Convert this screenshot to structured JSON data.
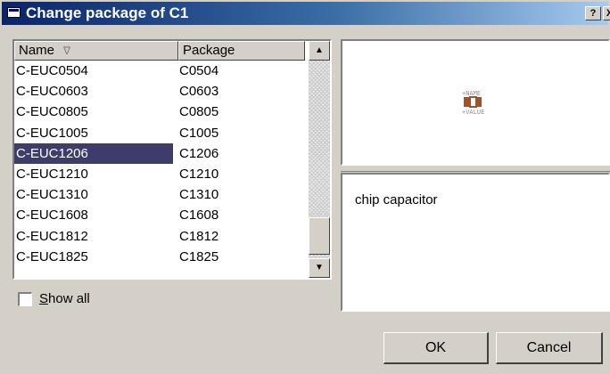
{
  "window": {
    "title": "Change package of C1",
    "help_label": "?",
    "close_label": "X"
  },
  "list": {
    "columns": {
      "name": "Name",
      "package": "Package"
    },
    "sort_indicator": "∇",
    "rows": [
      {
        "name": "C-EUC0504",
        "package": "C0504",
        "selected": false
      },
      {
        "name": "C-EUC0603",
        "package": "C0603",
        "selected": false
      },
      {
        "name": "C-EUC0805",
        "package": "C0805",
        "selected": false
      },
      {
        "name": "C-EUC1005",
        "package": "C1005",
        "selected": false
      },
      {
        "name": "C-EUC1206",
        "package": "C1206",
        "selected": true
      },
      {
        "name": "C-EUC1210",
        "package": "C1210",
        "selected": false
      },
      {
        "name": "C-EUC1310",
        "package": "C1310",
        "selected": false
      },
      {
        "name": "C-EUC1608",
        "package": "C1608",
        "selected": false
      },
      {
        "name": "C-EUC1812",
        "package": "C1812",
        "selected": false
      },
      {
        "name": "C-EUC1825",
        "package": "C1825",
        "selected": false
      }
    ],
    "scroll_up_icon": "▲",
    "scroll_down_icon": "▼"
  },
  "show_all": {
    "accel": "S",
    "rest": "how all",
    "checked": false
  },
  "preview": {
    "name_text": "+NAME",
    "value_text": "+VALUE",
    "pad_color": "#a0522d"
  },
  "description": "chip capacitor",
  "buttons": {
    "ok": "OK",
    "cancel": "Cancel"
  }
}
